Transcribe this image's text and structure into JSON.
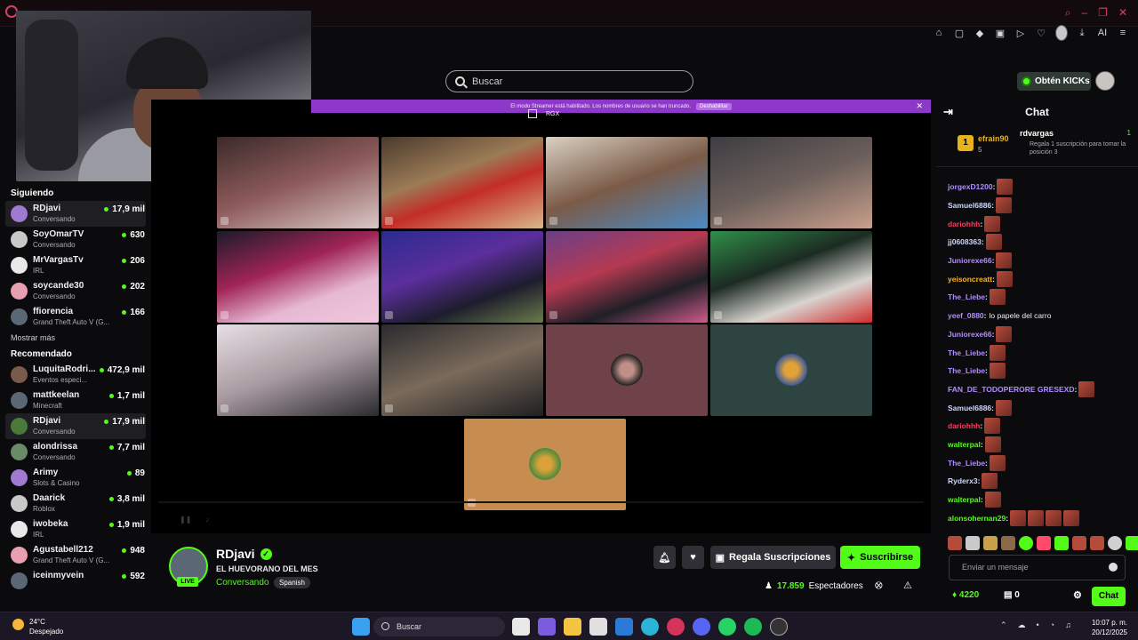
{
  "search": {
    "placeholder": "Buscar"
  },
  "header": {
    "kicks_label": "Obtén KICKs"
  },
  "sidebar": {
    "following_title": "Siguiendo",
    "following": [
      {
        "name": "RDjavi",
        "category": "Conversando",
        "viewers": "17,9 mil",
        "active": true
      },
      {
        "name": "SoyOmarTV",
        "category": "Conversando",
        "viewers": "630"
      },
      {
        "name": "MrVargasTv",
        "category": "IRL",
        "viewers": "206"
      },
      {
        "name": "soycande30",
        "category": "Conversando",
        "viewers": "202"
      },
      {
        "name": "ffiorencia",
        "category": "Grand Theft Auto V (G...",
        "viewers": "166"
      }
    ],
    "show_more": "Mostrar más",
    "recommended_title": "Recomendado",
    "recommended": [
      {
        "name": "LuquitaRodri...",
        "category": "Eventos especi...",
        "viewers": "472,9 mil"
      },
      {
        "name": "mattkeelan",
        "category": "Minecraft",
        "viewers": "1,7 mil"
      },
      {
        "name": "RDjavi",
        "category": "Conversando",
        "viewers": "17,9 mil",
        "active": true
      },
      {
        "name": "alondrissa",
        "category": "Conversando",
        "viewers": "7,7 mil"
      },
      {
        "name": "Arimy",
        "category": "Slots & Casino",
        "viewers": "89"
      },
      {
        "name": "Daarick",
        "category": "Roblox",
        "viewers": "3,8 mil"
      },
      {
        "name": "iwobeka",
        "category": "IRL",
        "viewers": "1,9 mil"
      },
      {
        "name": "Agustabell212",
        "category": "Grand Theft Auto V (G...",
        "viewers": "948"
      },
      {
        "name": "iceinmyvein",
        "category": "",
        "viewers": "592"
      }
    ]
  },
  "player": {
    "banner_text": "El modo Streamer está habilitado. Los nombres de usuario se han truncado.",
    "banner_button": "Deshabilitar",
    "pip_label": "RGX"
  },
  "channel": {
    "name": "RDjavi",
    "title": "EL HUEVORANO DEL MES",
    "category": "Conversando",
    "tag": "Spanish",
    "live": "LIVE",
    "gift_label": "Regala Suscripciones",
    "subscribe_label": "Suscribirse",
    "viewers_count": "17.859",
    "viewers_label": "Espectadores"
  },
  "chat": {
    "title": "Chat",
    "leader1": {
      "rank": "1",
      "name": "efrain90",
      "count": "5"
    },
    "leader2": {
      "name": "rdvargas",
      "count": "1",
      "text": "Regala 1 suscripción para tomar la posición 3"
    },
    "messages": [
      {
        "user": "jorgexD1200",
        "color": "#b18cff",
        "emotes": 1,
        "text": ""
      },
      {
        "user": "Samuel6886",
        "color": "#cfd6ff",
        "emotes": 1,
        "text": ""
      },
      {
        "user": "dariohhh",
        "color": "#ff3b5c",
        "emotes": 1,
        "text": ""
      },
      {
        "user": "jj0608363",
        "color": "#cfd6ff",
        "emotes": 1,
        "text": ""
      },
      {
        "user": "Juniorexe66",
        "color": "#b18cff",
        "emotes": 1,
        "text": ""
      },
      {
        "user": "yeisoncreatt",
        "color": "#ffb31a",
        "emotes": 1,
        "text": ""
      },
      {
        "user": "The_Liebe",
        "color": "#b18cff",
        "emotes": 1,
        "text": ""
      },
      {
        "user": "yeef_0880",
        "color": "#b18cff",
        "emotes": 0,
        "text": "lo papele del carro"
      },
      {
        "user": "Juniorexe66",
        "color": "#b18cff",
        "emotes": 1,
        "text": ""
      },
      {
        "user": "The_Liebe",
        "color": "#b18cff",
        "emotes": 1,
        "text": ""
      },
      {
        "user": "The_Liebe",
        "color": "#b18cff",
        "emotes": 1,
        "text": ""
      },
      {
        "user": "FAN_DE_TODOPERORE GRESEXD",
        "color": "#b18cff",
        "emotes": 1,
        "text": ""
      },
      {
        "user": "Samuel6886",
        "color": "#cfd6ff",
        "emotes": 1,
        "text": ""
      },
      {
        "user": "dariohhh",
        "color": "#ff3b5c",
        "emotes": 1,
        "text": ""
      },
      {
        "user": "walterpal",
        "color": "#53fc18",
        "emotes": 1,
        "text": ""
      },
      {
        "user": "The_Liebe",
        "color": "#b18cff",
        "emotes": 1,
        "text": ""
      },
      {
        "user": "Ryderx3",
        "color": "#cfd6ff",
        "emotes": 1,
        "text": ""
      },
      {
        "user": "walterpal",
        "color": "#53fc18",
        "emotes": 1,
        "text": ""
      },
      {
        "user": "alonsohernan29",
        "color": "#53fc18",
        "emotes": 4,
        "text": ""
      }
    ],
    "input_placeholder": "Enviar un mensaje",
    "points": "4220",
    "sub_count": "0",
    "send_label": "Chat"
  },
  "taskbar": {
    "temperature": "24°C",
    "weather": "Despejado",
    "search": "Buscar",
    "time": "10:07 p. m.",
    "date": "20/12/2025"
  }
}
